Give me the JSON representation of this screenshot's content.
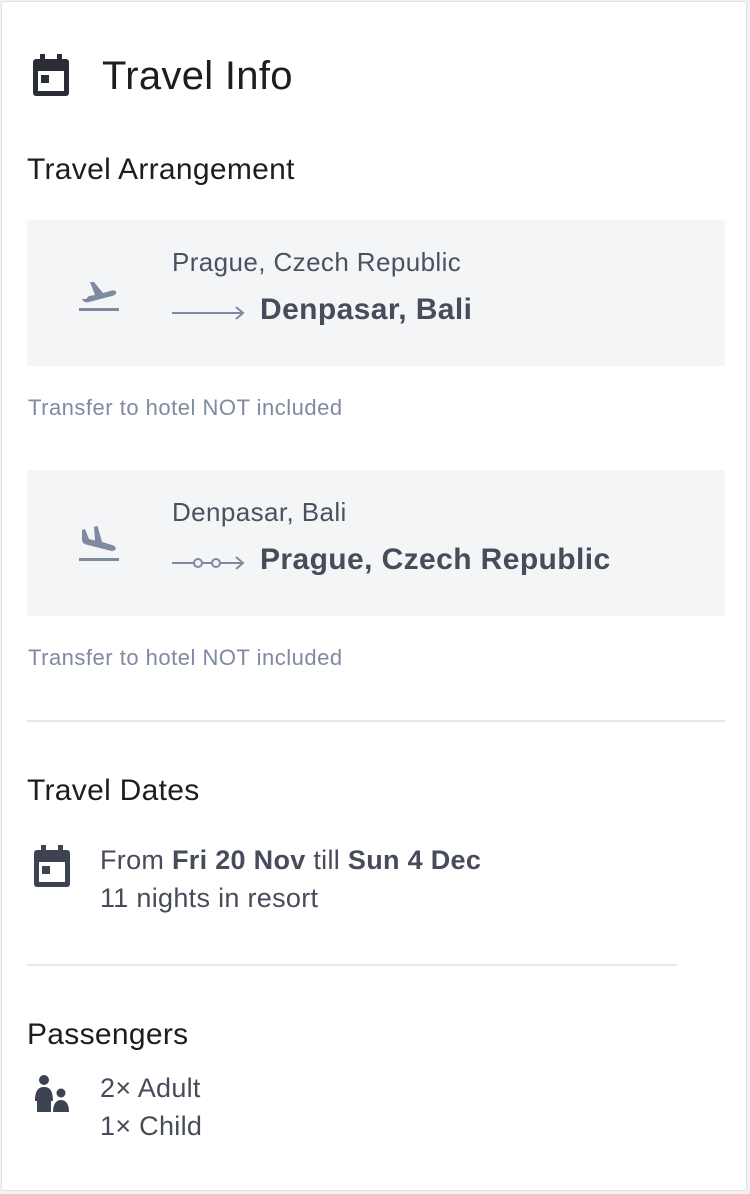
{
  "header": {
    "title": "Travel Info",
    "icon": "calendar-icon"
  },
  "travel_arrangement": {
    "heading": "Travel Arrangement",
    "legs": [
      {
        "from": "Prague, Czech Republic",
        "to": "Denpasar, Bali",
        "icon": "plane-takeoff-icon",
        "connector": "direct-arrow",
        "note": "Transfer to hotel NOT included"
      },
      {
        "from": "Denpasar, Bali",
        "to": "Prague, Czech Republic",
        "icon": "plane-landing-icon",
        "connector": "stops-arrow",
        "note": "Transfer to hotel NOT included"
      }
    ]
  },
  "travel_dates": {
    "heading": "Travel Dates",
    "icon": "calendar-icon",
    "from_word": "From",
    "start": "Fri 20 Nov",
    "till_word": "till",
    "end": "Sun 4 Dec",
    "nights": "11 nights in resort"
  },
  "passengers": {
    "heading": "Passengers",
    "icon": "people-icon",
    "adults": "2× Adult",
    "children": "1× Child"
  },
  "colors": {
    "text_primary": "#1c1d21",
    "text_secondary": "#464c59",
    "muted": "#7f8aa0",
    "panel_bg": "#f4f5f7",
    "icon_slate": "#7f8aa0",
    "icon_dark": "#3d4350"
  }
}
